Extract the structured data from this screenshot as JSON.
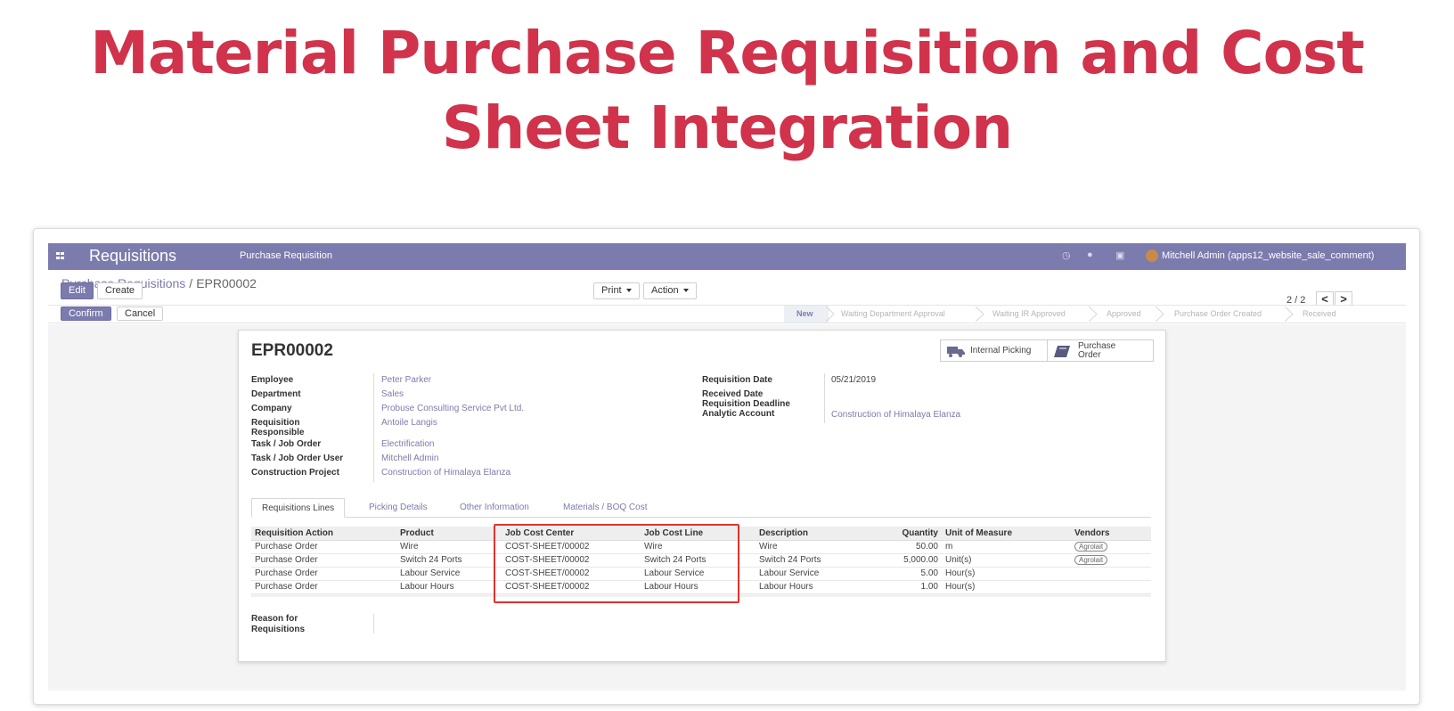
{
  "banner": {
    "title": "Material Purchase Requisition and Cost Sheet Integration"
  },
  "topbar": {
    "app_name": "Requisitions",
    "menu_item": "Purchase Requisition",
    "user": "Mitchell Admin (apps12_website_sale_comment)"
  },
  "breadcrumb": {
    "parent": "Purchase Requisitions",
    "separator": "/",
    "current": "EPR00002"
  },
  "control": {
    "edit": "Edit",
    "create": "Create",
    "print": "Print",
    "action": "Action",
    "pager": "2 / 2",
    "prev": "<",
    "next": ">"
  },
  "statusbar": {
    "confirm": "Confirm",
    "cancel": "Cancel",
    "stages": [
      "New",
      "Waiting Department Approval",
      "Waiting IR Approved",
      "Approved",
      "Purchase Order Created",
      "Received"
    ],
    "active_stage": "New"
  },
  "form": {
    "title": "EPR00002",
    "smart_buttons": {
      "internal_picking": "Internal Picking",
      "purchase_order_1": "Purchase",
      "purchase_order_2": "Order"
    },
    "left_fields": [
      {
        "label": "Employee",
        "value": "Peter Parker"
      },
      {
        "label": "Department",
        "value": "Sales"
      },
      {
        "label": "Company",
        "value": "Probuse Consulting Service Pvt Ltd."
      },
      {
        "label": "Requisition Responsible",
        "value": "Antoile Langis"
      },
      {
        "label": "Task / Job Order",
        "value": "Electrification"
      },
      {
        "label": "Task / Job Order User",
        "value": "Mitchell Admin"
      },
      {
        "label": "Construction Project",
        "value": "Construction of Himalaya Elanza"
      }
    ],
    "right_fields": [
      {
        "label": "Requisition Date",
        "value": "05/21/2019"
      },
      {
        "label": "Received Date",
        "value": ""
      },
      {
        "label": "Requisition Deadline",
        "value": ""
      },
      {
        "label": "Analytic Account",
        "value": "Construction of Himalaya Elanza"
      }
    ],
    "tabs": [
      "Requisitions Lines",
      "Picking Details",
      "Other Information",
      "Materials / BOQ Cost"
    ],
    "table": {
      "columns": [
        "Requisition Action",
        "Product",
        "Job Cost Center",
        "Job Cost Line",
        "Description",
        "Quantity",
        "Unit of Measure",
        "Vendors"
      ],
      "rows": [
        [
          "Purchase Order",
          "Wire",
          "COST-SHEET/00002",
          "Wire",
          "Wire",
          "50.00",
          "m",
          "Agrolait"
        ],
        [
          "Purchase Order",
          "Switch 24 Ports",
          "COST-SHEET/00002",
          "Switch 24 Ports",
          "Switch 24 Ports",
          "5,000.00",
          "Unit(s)",
          "Agrolait"
        ],
        [
          "Purchase Order",
          "Labour Service",
          "COST-SHEET/00002",
          "Labour Service",
          "Labour Service",
          "5.00",
          "Hour(s)",
          ""
        ],
        [
          "Purchase Order",
          "Labour Hours",
          "COST-SHEET/00002",
          "Labour Hours",
          "Labour Hours",
          "1.00",
          "Hour(s)",
          ""
        ]
      ]
    },
    "reason_label": "Reason for Requisitions"
  },
  "colors": {
    "brand": "#7c7bad",
    "banner": "#d0334b",
    "highlight": "#e0322c"
  },
  "icons": [
    "apps-icon",
    "clock-icon",
    "chat-icon",
    "gift-icon",
    "truck-icon",
    "book-icon",
    "caret-down-icon"
  ]
}
